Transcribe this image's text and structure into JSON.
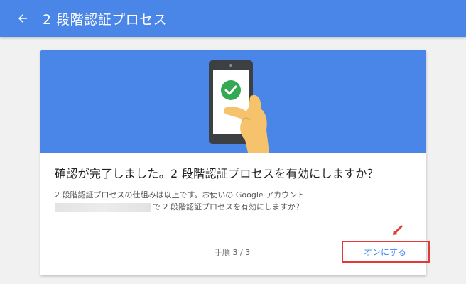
{
  "header": {
    "title": "2 段階認証プロセス",
    "back_icon": "arrow-back-icon"
  },
  "card": {
    "headline": "確認が完了しました。2 段階認証プロセスを有効にしますか？",
    "desc_line1": "2 段階認証プロセスの仕組みは以上です。お使いの Google アカウント",
    "desc_line2_suffix": "で 2 段階認証プロセスを有効にしますか？",
    "step": "手順 3 / 3",
    "on_button": "オンにする"
  },
  "colors": {
    "header_bg": "#4a86e8",
    "banner_bg": "#4a86e8",
    "link": "#4285f4",
    "highlight": "#e53935",
    "check": "#34a853"
  },
  "icons": [
    "arrow-back-icon",
    "phone-check-illustration",
    "check-circle-icon",
    "red-pointer-arrow-icon"
  ]
}
